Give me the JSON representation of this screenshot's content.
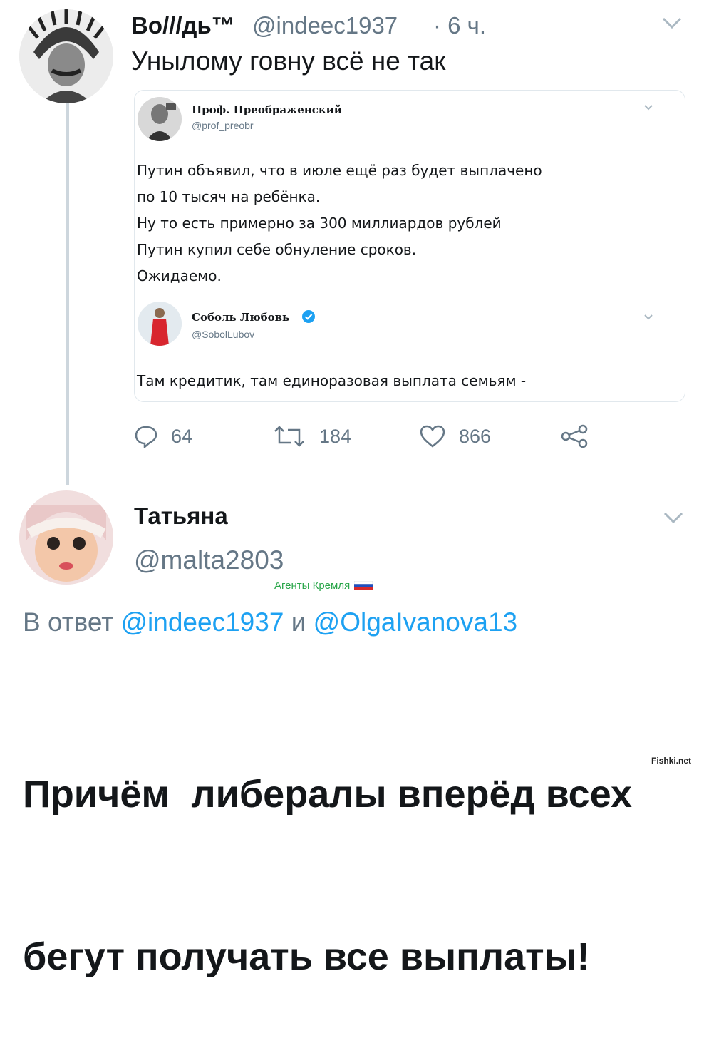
{
  "tweet1": {
    "name": "Во///дь™",
    "handle": "@indeec1937",
    "time": "· 6 ч.",
    "text": "Унылому говну всё не так",
    "quoted": {
      "name": "Проф. Преображенский",
      "handle": "@prof_preobr",
      "lines": [
        "Путин объявил, что в июле ещё раз будет выплачено",
        "по 10 тысяч на ребёнка.",
        "Ну то есть примерно за 300 миллиардов рублей",
        "Путин купил себе обнуление сроков.",
        "Ожидаемо."
      ],
      "nested": {
        "name": "Соболь Любовь",
        "handle": "@SobolLubov",
        "text": "Там кредитик, там единоразовая выплата семьям -"
      }
    },
    "actions": {
      "replies": "64",
      "retweets": "184",
      "likes": "866"
    }
  },
  "tweet2": {
    "name": "Татьяна",
    "handle": "@malta2803",
    "badge": "Агенты Кремля",
    "reply_prefix": "В ответ",
    "reply_to_1": "@indeec1937",
    "reply_join": "и",
    "reply_to_2": "@OlgaIvanova13",
    "text_line1": "Причём  либералы вперёд всех",
    "text_line2": "бегут получать все выплаты!"
  },
  "watermark": "Fishki.net",
  "colors": {
    "link": "#1da1f2",
    "muted": "#657786",
    "text": "#14171a",
    "line": "#cdd6dd",
    "verified": "#1da1f2",
    "badge": "#2aa64a"
  },
  "icons": [
    "chevron-down-icon",
    "reply-icon",
    "retweet-icon",
    "like-icon",
    "share-icon",
    "verified-icon",
    "flag-icon"
  ]
}
